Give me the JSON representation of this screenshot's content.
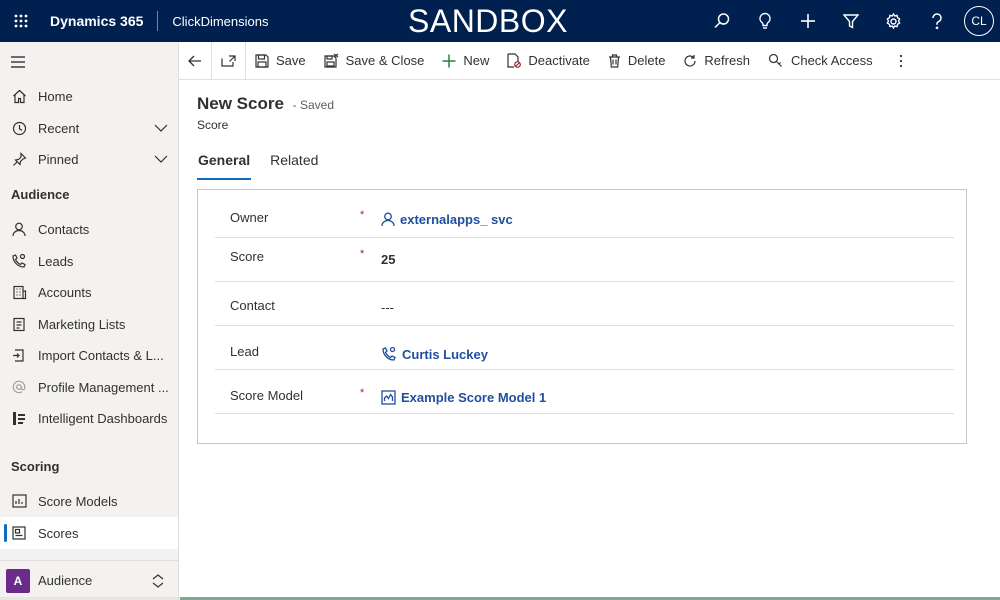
{
  "topbar": {
    "app_name": "Dynamics 365",
    "module_name": "ClickDimensions",
    "environment_banner": "SANDBOX",
    "icons": [
      "search-icon",
      "lightbulb-icon",
      "add-icon",
      "filter-icon",
      "settings-icon",
      "help-icon"
    ],
    "user_initials": "CL"
  },
  "sidebar": {
    "items": [
      {
        "label": "Home",
        "icon": "home-icon"
      },
      {
        "label": "Recent",
        "icon": "clock-icon"
      },
      {
        "label": "Pinned",
        "icon": "pin-icon"
      }
    ],
    "groups": [
      {
        "title": "Audience",
        "items": [
          {
            "label": "Contacts",
            "icon": "person-icon"
          },
          {
            "label": "Leads",
            "icon": "phone-person-icon"
          },
          {
            "label": "Accounts",
            "icon": "building-icon"
          },
          {
            "label": "Marketing Lists",
            "icon": "list-icon"
          },
          {
            "label": "Import Contacts & L...",
            "icon": "import-icon"
          },
          {
            "label": "Profile Management ...",
            "icon": "at-icon"
          },
          {
            "label": "Intelligent Dashboards",
            "icon": "dashboard-icon"
          }
        ]
      },
      {
        "title": "Scoring",
        "items": [
          {
            "label": "Score Models",
            "icon": "chart-icon"
          },
          {
            "label": "Scores",
            "icon": "score-card-icon"
          }
        ]
      }
    ],
    "area": {
      "badge": "A",
      "label": "Audience",
      "badge_color": "#6b2b8a"
    }
  },
  "commands": {
    "save": "Save",
    "save_close": "Save & Close",
    "new": "New",
    "deactivate": "Deactivate",
    "delete": "Delete",
    "refresh": "Refresh",
    "check_access": "Check Access"
  },
  "form": {
    "title": "New Score",
    "status": "- Saved",
    "entity": "Score",
    "tabs": [
      "General",
      "Related"
    ],
    "fields": [
      {
        "label": "Owner",
        "required": "*",
        "value": "externalapps_ svc",
        "icon": "person-icon"
      },
      {
        "label": "Score",
        "required": "*",
        "value": "25"
      },
      {
        "label": "Contact",
        "required": "",
        "value": "---"
      },
      {
        "label": "Lead",
        "required": "",
        "value": "Curtis Luckey",
        "icon": "phone-person-icon"
      },
      {
        "label": "Score Model",
        "required": "*",
        "value": "Example Score Model 1",
        "icon": "score-model-icon"
      }
    ]
  },
  "colors": {
    "topbar": "#002050",
    "accent": "#0f6cbd",
    "link": "#1f4f9c",
    "required": "#a4262c"
  }
}
